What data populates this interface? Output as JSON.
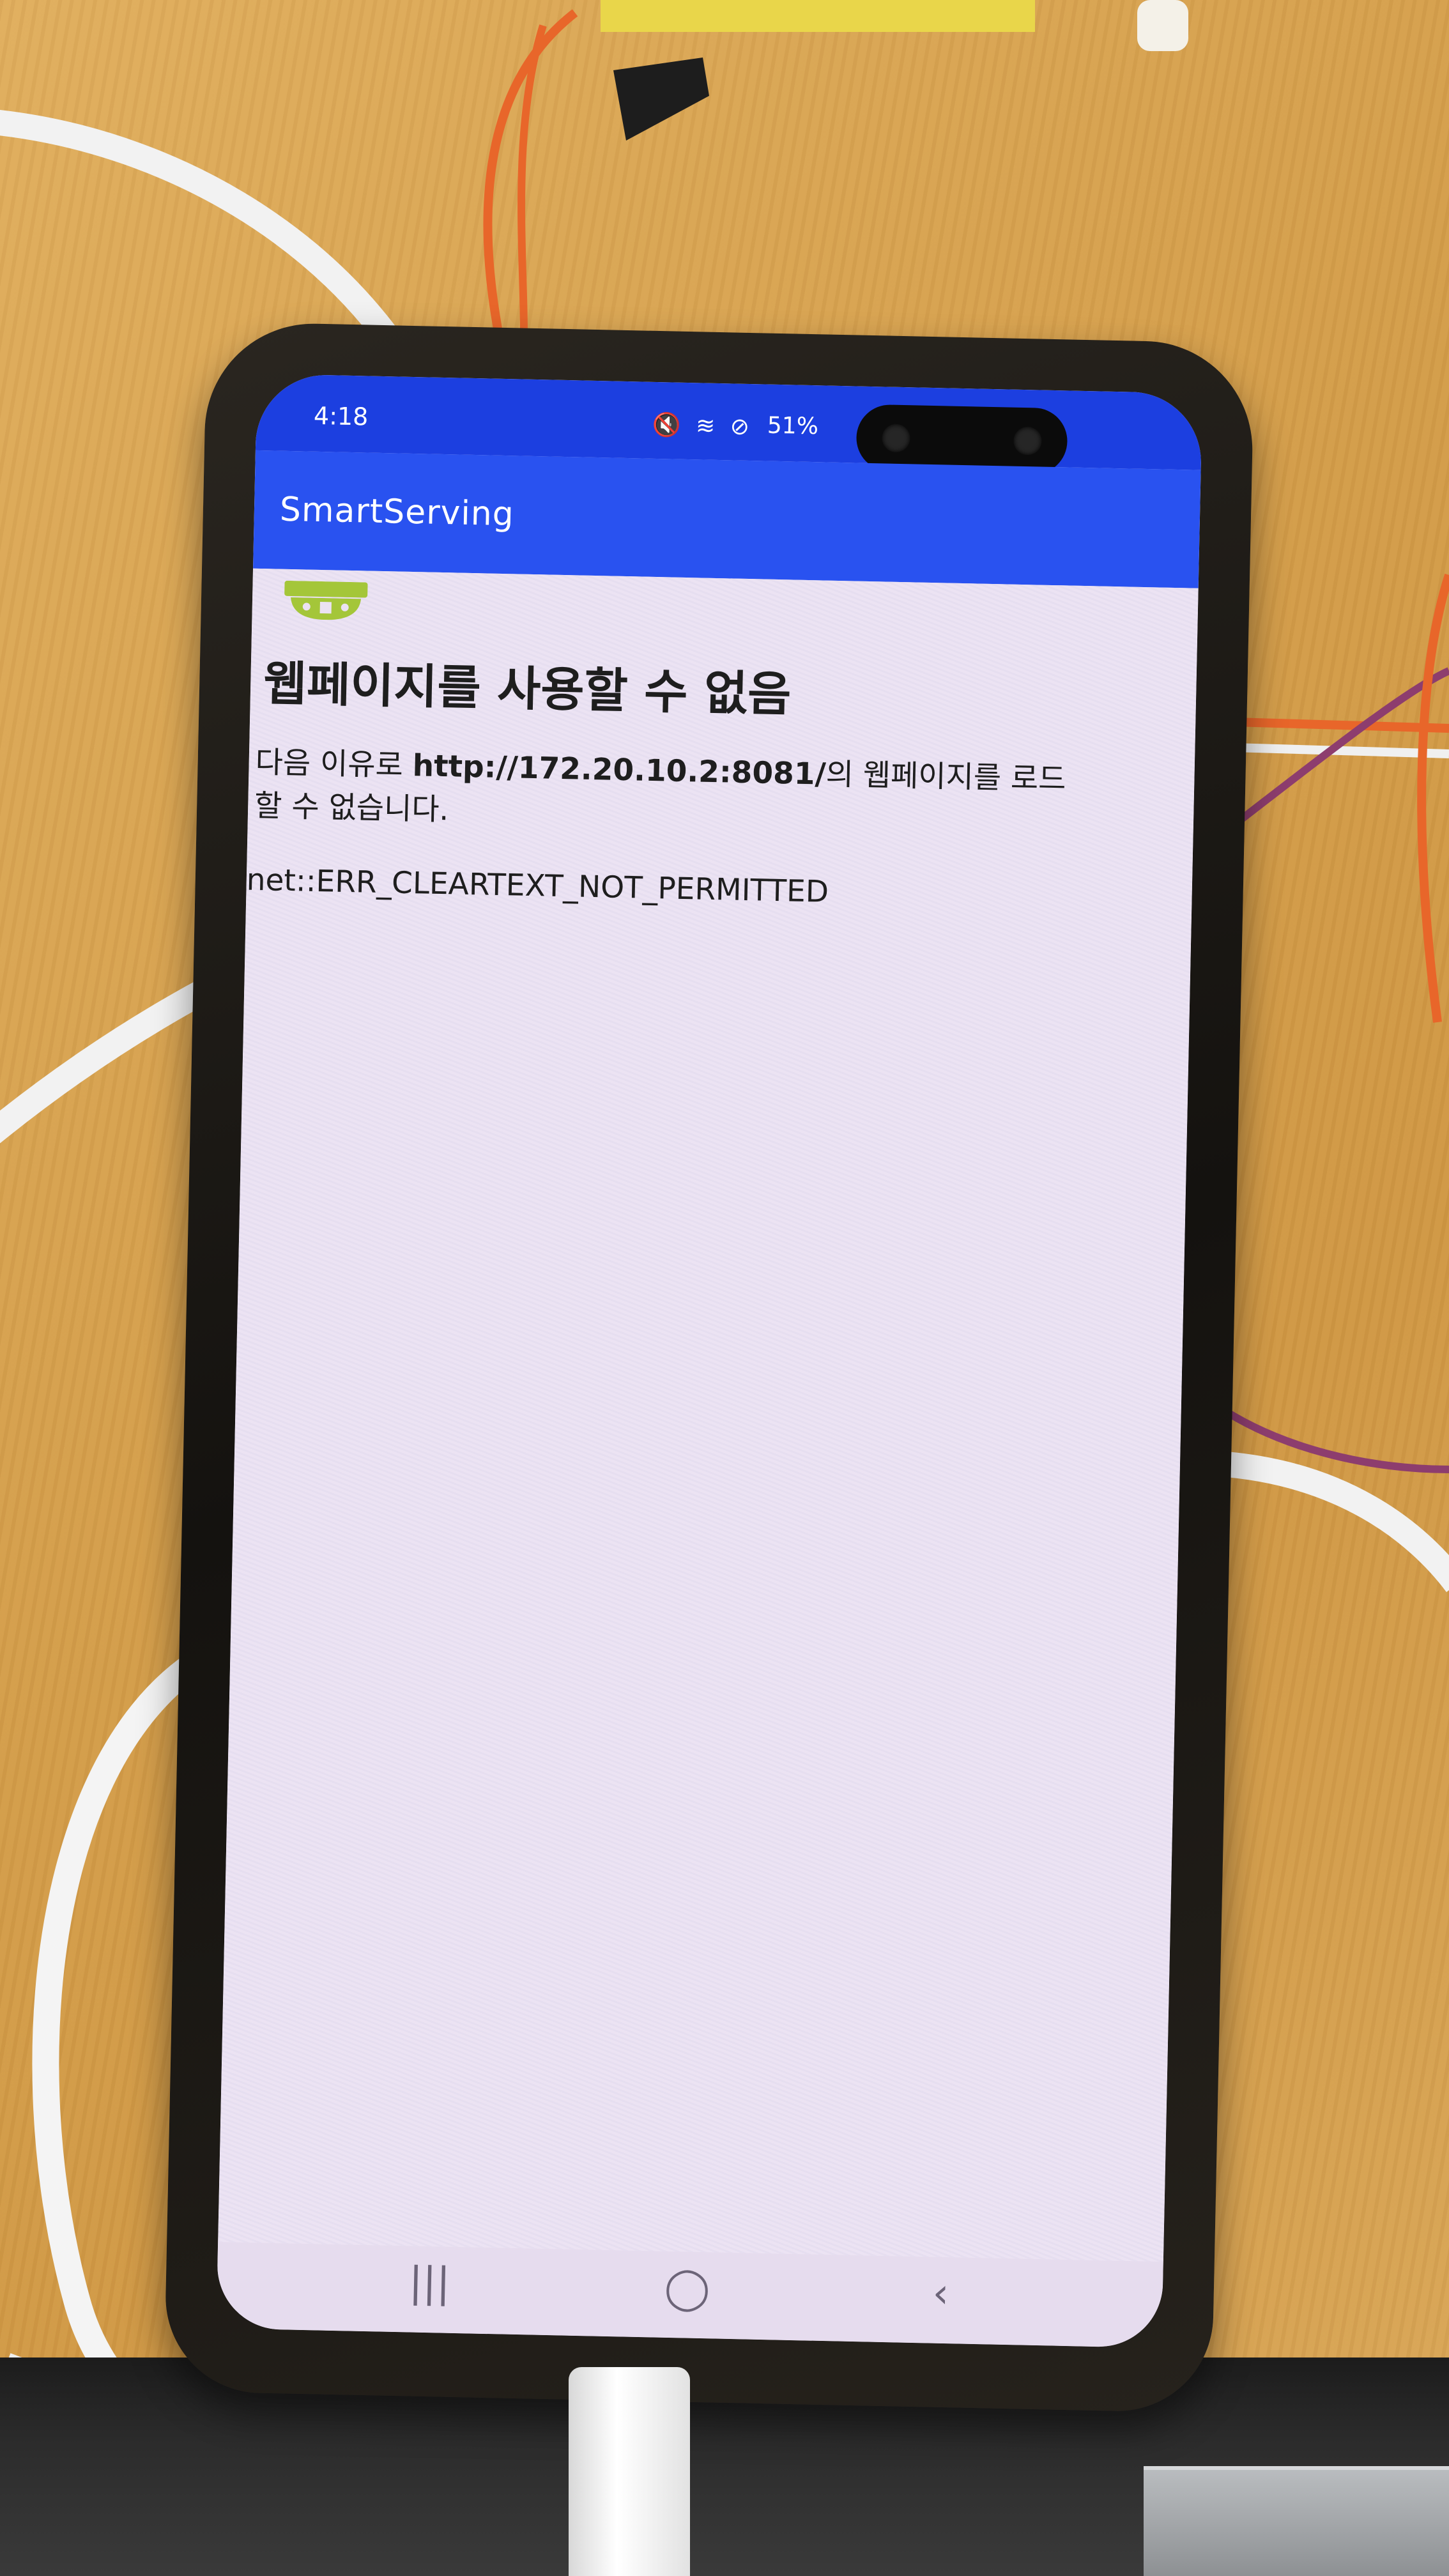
{
  "status_bar": {
    "time": "4:18",
    "icons": "🔇 ≋ ⊘",
    "battery": "51%"
  },
  "app_bar": {
    "title": "SmartServing"
  },
  "error_page": {
    "title": "웹페이지를 사용할 수 없음",
    "message_prefix": "다음 이유로 ",
    "url": "http://172.20.10.2:8081/",
    "message_suffix": "의 웹페이지를 로드할 수 없습니다.",
    "error_code": "net::ERR_CLEARTEXT_NOT_PERMITTED"
  },
  "nav_bar": {
    "recents": "|||",
    "home": "◯",
    "back": "‹"
  },
  "colors": {
    "status_bar": "#1c3fe0",
    "app_bar": "#2952f0",
    "page_background": "#ebe2f2",
    "android_icon": "#a4c639"
  },
  "icons": [
    "android-icon",
    "mute-icon",
    "wifi-icon",
    "do-not-disturb-icon",
    "battery-icon"
  ]
}
